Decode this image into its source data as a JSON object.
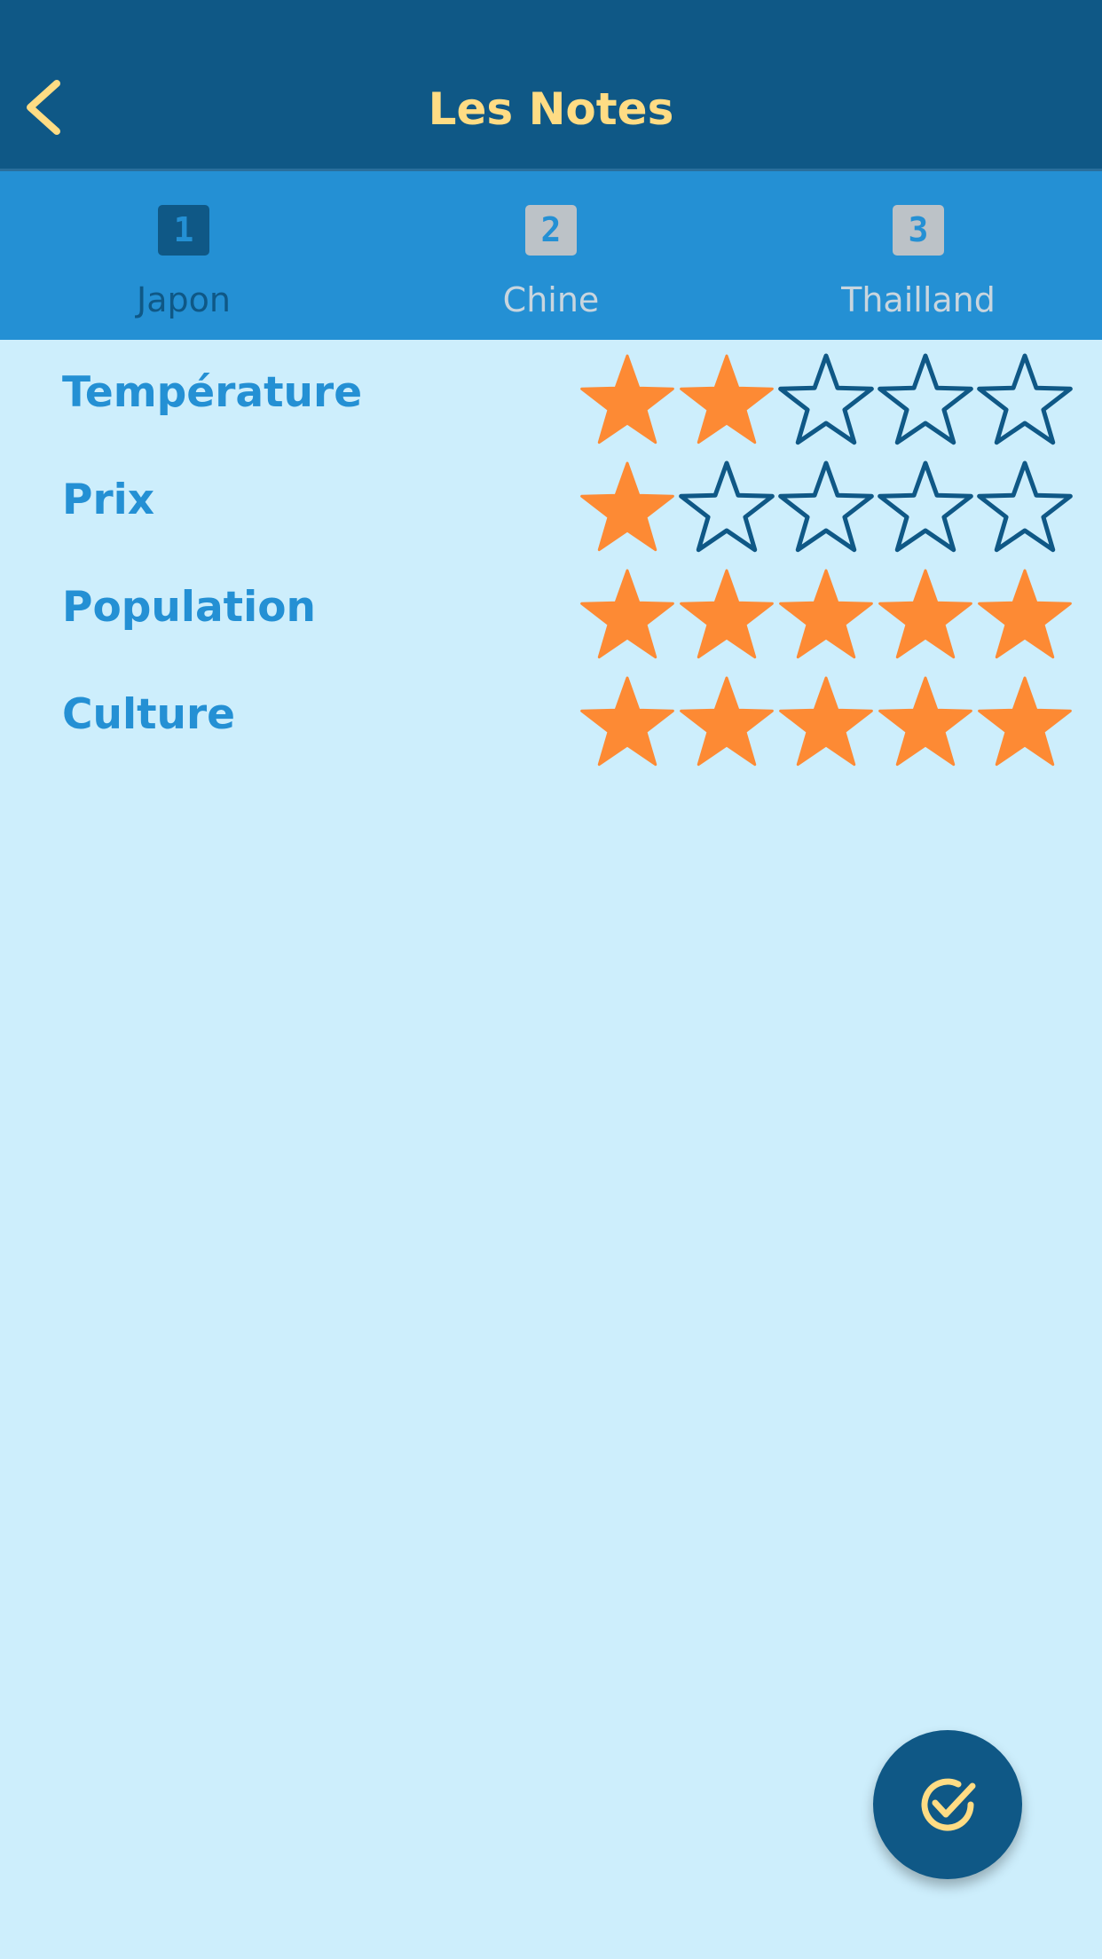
{
  "header": {
    "title": "Les Notes",
    "back_icon": "chevron-left-icon"
  },
  "tabs": [
    {
      "number": "1",
      "label": "Japon",
      "active": true
    },
    {
      "number": "2",
      "label": "Chine",
      "active": false
    },
    {
      "number": "3",
      "label": "Thailland",
      "active": false
    }
  ],
  "ratings": [
    {
      "label": "Température",
      "value": 2,
      "max": 5
    },
    {
      "label": "Prix",
      "value": 1,
      "max": 5
    },
    {
      "label": "Population",
      "value": 5,
      "max": 5
    },
    {
      "label": "Culture",
      "value": 5,
      "max": 5
    }
  ],
  "fab": {
    "icon": "check-circle-icon"
  },
  "colors": {
    "appbar": "#0f5886",
    "tabbar": "#2490d4",
    "background": "#cdeefc",
    "title": "#ffdc84",
    "star_filled": "#fd8a34",
    "star_outline": "#0f5886",
    "label": "#2490d4"
  }
}
